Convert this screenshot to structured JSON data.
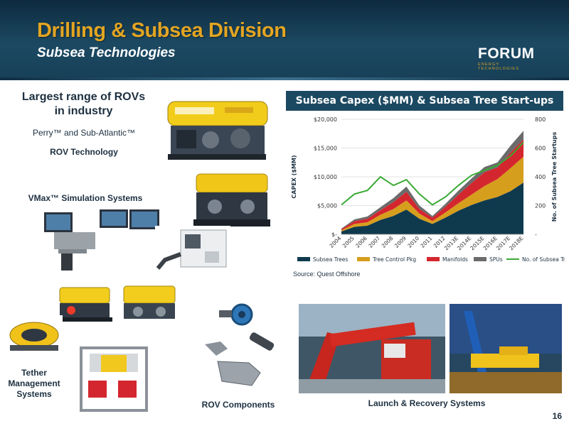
{
  "header": {
    "title": "Drilling & Subsea Division",
    "subtitle": "Subsea Technologies",
    "logo_text": "FORUM",
    "logo_tagline": "ENERGY TECHNOLOGIES"
  },
  "left": {
    "largest_range": "Largest range of ROVs in industry",
    "perry_line": "Perry™ and Sub-Atlantic™",
    "rov_technology": "ROV Technology",
    "vmax": "VMax™ Simulation Systems",
    "tether": "Tether Management Systems",
    "rov_components": "ROV Components"
  },
  "right": {
    "chart_banner": "Subsea Capex ($MM) & Subsea Tree Start-ups",
    "source": "Source: Quest Offshore",
    "launch_recovery": "Launch & Recovery Systems"
  },
  "page_number": "16",
  "colors": {
    "title_gold": "#e3a522",
    "header_blue": "#1c4962",
    "subsea_trees": "#0f3a4e",
    "tree_control_pkg": "#d69e1d",
    "manifolds": "#d4262e",
    "spus": "#6b6b6b",
    "subsea_tree_line": "#3aaa35"
  },
  "chart_data": {
    "type": "area",
    "x": [
      "2004",
      "2005",
      "2006",
      "2007",
      "2008",
      "2009",
      "2010",
      "2011",
      "2012",
      "2013E",
      "2014E",
      "2015E",
      "2016E",
      "2017E",
      "2018E"
    ],
    "stacked": true,
    "series": [
      {
        "name": "Subsea Trees",
        "values": [
          500,
          1300,
          1500,
          2500,
          3200,
          4300,
          2700,
          1800,
          2900,
          4100,
          5100,
          5900,
          6500,
          7500,
          9000
        ]
      },
      {
        "name": "Tree Control Pkg",
        "values": [
          200,
          500,
          600,
          900,
          1200,
          1600,
          900,
          500,
          900,
          1300,
          1800,
          2500,
          3100,
          4000,
          4500
        ]
      },
      {
        "name": "Manifolds",
        "values": [
          200,
          500,
          600,
          800,
          1200,
          1500,
          800,
          600,
          1000,
          1500,
          2000,
          2400,
          2000,
          2700,
          3000
        ]
      },
      {
        "name": "SPUs",
        "values": [
          100,
          300,
          400,
          500,
          700,
          900,
          600,
          300,
          500,
          700,
          800,
          900,
          900,
          1200,
          1500
        ]
      }
    ],
    "line_series": {
      "name": "No. of Subsea Trees",
      "axis": "right",
      "values": [
        205,
        280,
        305,
        400,
        340,
        380,
        280,
        205,
        260,
        340,
        410,
        445,
        480,
        545,
        640
      ]
    },
    "ylabel": "CAPEX ($MM)",
    "y2label": "No. of Subsea Tree Startups",
    "ylim": [
      0,
      20000
    ],
    "y2lim": [
      0,
      800
    ],
    "yticks": [
      "$-",
      "$5,000",
      "$10,000",
      "$15,000",
      "$20,000"
    ],
    "y2ticks": [
      "-",
      "200",
      "400",
      "600",
      "800"
    ],
    "legend_position": "bottom",
    "grid": true
  }
}
